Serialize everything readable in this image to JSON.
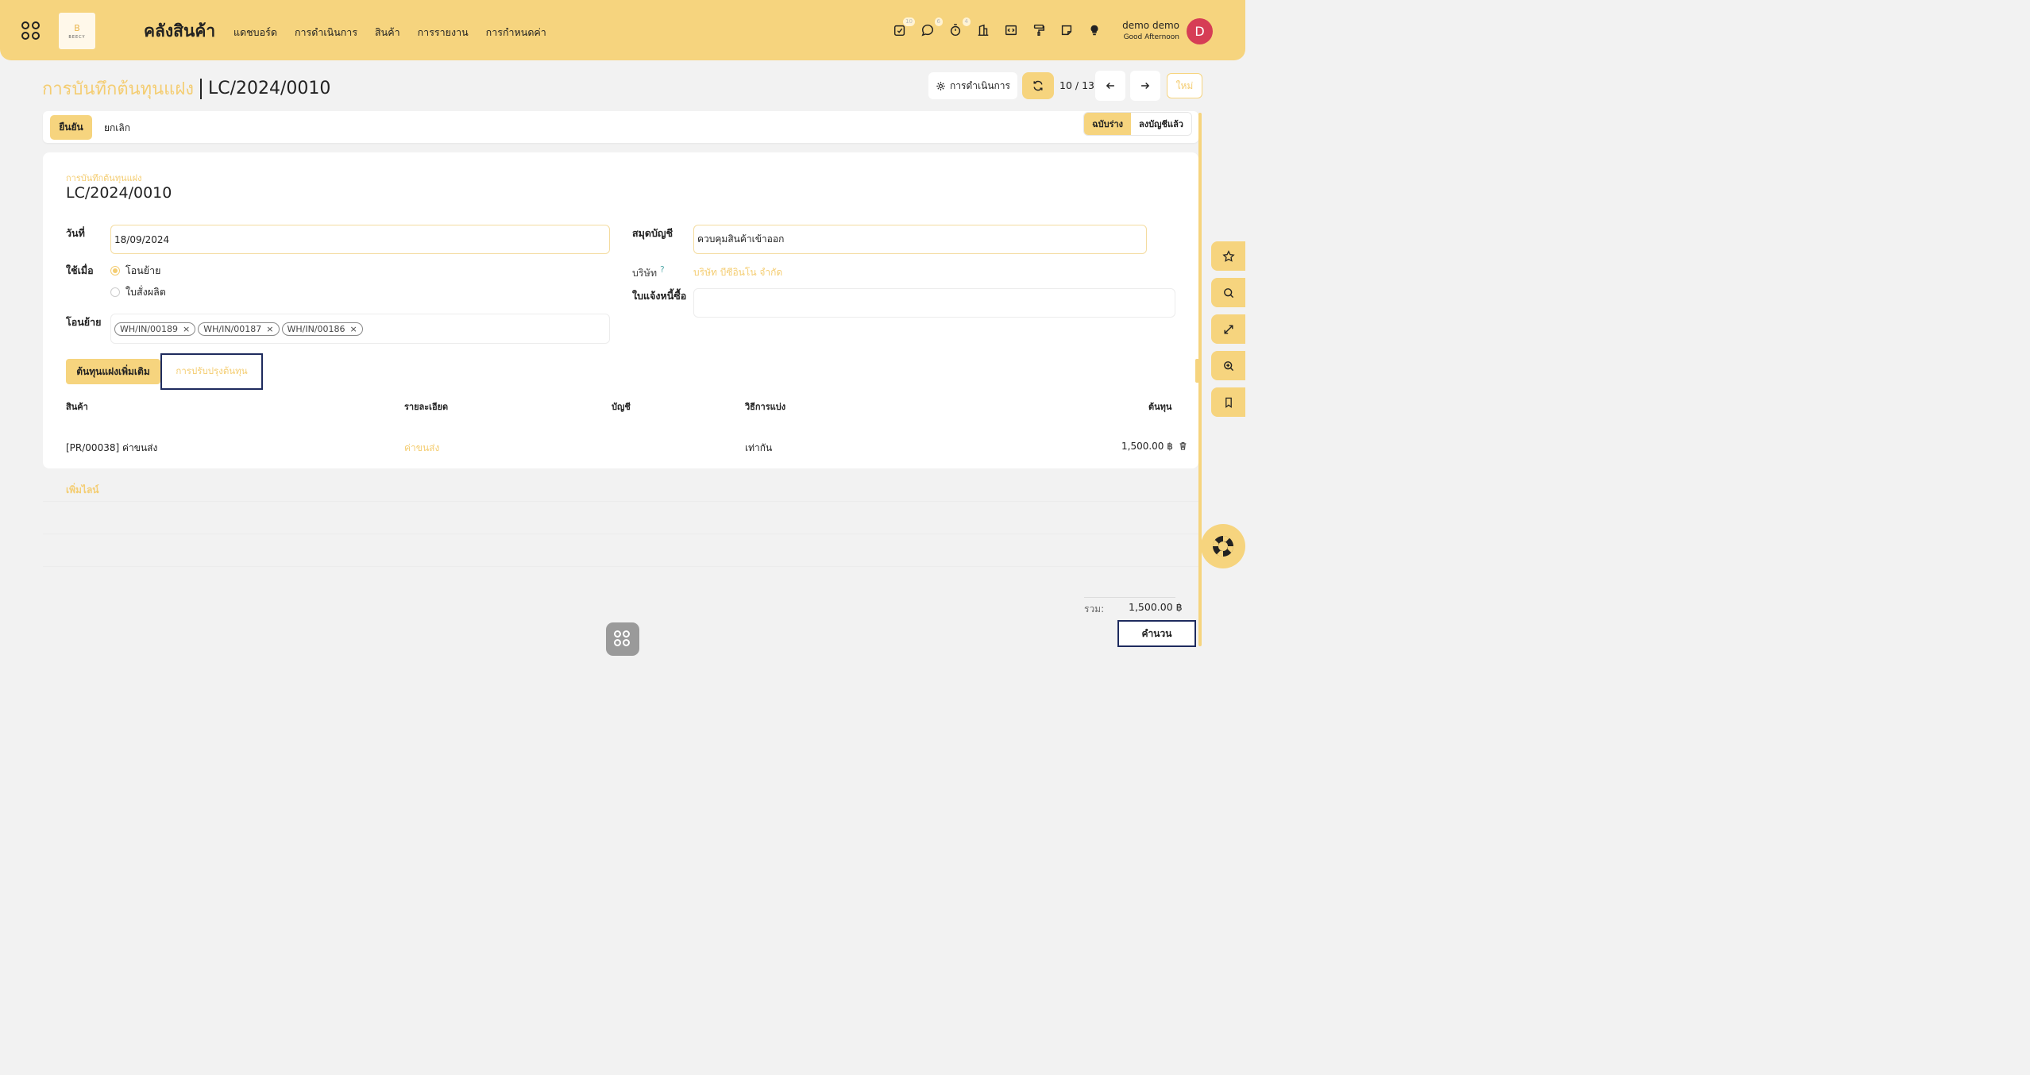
{
  "topbar": {
    "app_title": "คลังสินค้า",
    "logo_text": "B",
    "logo_sub": "BEECY",
    "nav": [
      "แดชบอร์ด",
      "การดำเนินการ",
      "สินค้า",
      "การรายงาน",
      "การกำหนดค่า"
    ],
    "badges": {
      "activity": "10",
      "messages": "6",
      "timer": "4"
    },
    "user_name": "demo demo",
    "greeting": "Good Afternoon",
    "avatar_letter": "D"
  },
  "control": {
    "breadcrumb_parent": "การบันทึกต้นทุนแฝง",
    "breadcrumb_current": "LC/2024/0010",
    "action_label": "การดำเนินการ",
    "pager": "10 / 13",
    "new_label": "ใหม่"
  },
  "statusbar": {
    "confirm_label": "ยืนยัน",
    "cancel_label": "ยกเลิก",
    "states": [
      "ฉบับร่าง",
      "ลงบัญชีแล้ว"
    ]
  },
  "form": {
    "record_label": "การบันทึกต้นทุนแฝง",
    "record_name": "LC/2024/0010",
    "date_label": "วันที่",
    "date_value": "18/09/2024",
    "apply_label": "ใช้เมื่อ",
    "apply_options": [
      "โอนย้าย",
      "ใบสั่งผลิต"
    ],
    "transfers_label": "โอนย้าย",
    "transfers": [
      "WH/IN/00189",
      "WH/IN/00187",
      "WH/IN/00186"
    ],
    "journal_label": "สมุดบัญชี",
    "journal_value": "ควบคุมสินค้าเข้าออก",
    "company_label": "บริษัท",
    "company_help": "?",
    "company_value": "บริษัท บีซีอินโน จำกัด",
    "bill_label": "ใบแจ้งหนี้ซื้อ",
    "bill_value": ""
  },
  "tabs": [
    "ต้นทุนแฝงเพิ่มเติม",
    "การปรับปรุงต้นทุน"
  ],
  "table": {
    "headers": [
      "สินค้า",
      "รายละเอียด",
      "บัญชี",
      "วิธีการแบ่ง",
      "ต้นทุน"
    ],
    "rows": [
      {
        "product": "[PR/00038] ค่าขนส่ง",
        "description": "ค่าขนส่ง",
        "account": "",
        "split": "เท่ากัน",
        "cost": "1,500.00 ฿"
      }
    ],
    "add_line": "เพิ่มไลน์"
  },
  "totals": {
    "label": "รวม:",
    "value": "1,500.00 ฿",
    "compute_label": "คำนวน"
  },
  "colors": {
    "accent": "#f6d47e",
    "accent_text": "#f4cd72",
    "highlight_border": "#1e2b5e",
    "avatar": "#d63d55"
  }
}
